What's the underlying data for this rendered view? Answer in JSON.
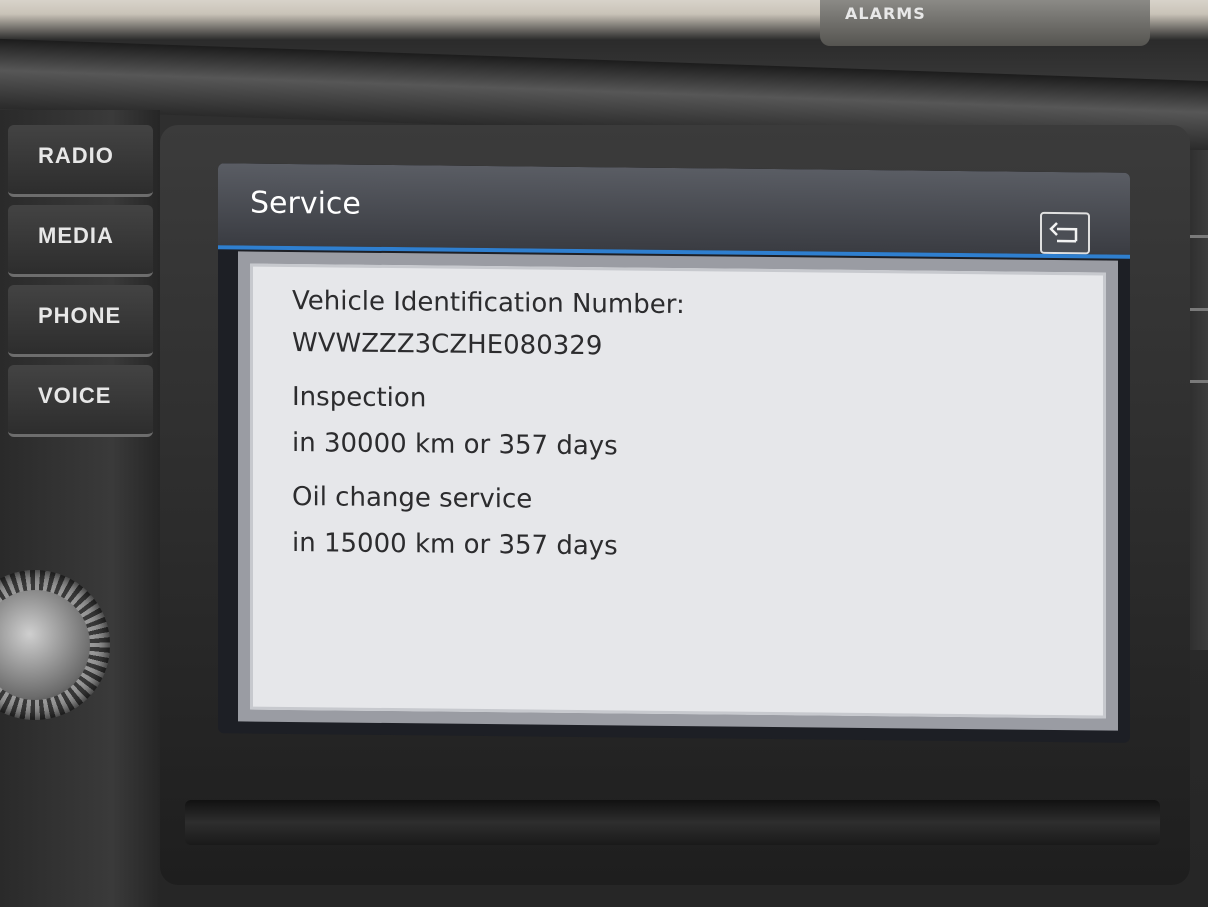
{
  "console": {
    "top_badge": "ALARMS",
    "side_buttons": [
      {
        "label": "RADIO"
      },
      {
        "label": "MEDIA"
      },
      {
        "label": "PHONE"
      },
      {
        "label": "VOICE"
      }
    ]
  },
  "screen": {
    "title": "Service",
    "back_icon": "back-arrow-icon",
    "accent_color": "#2f7fcf",
    "lines": [
      "Vehicle Identification Number:",
      "WVWZZZ3CZHE080329",
      "Inspection",
      "in 30000 km or 357 days",
      "Oil change service",
      "in 15000 km or 357 days"
    ]
  }
}
